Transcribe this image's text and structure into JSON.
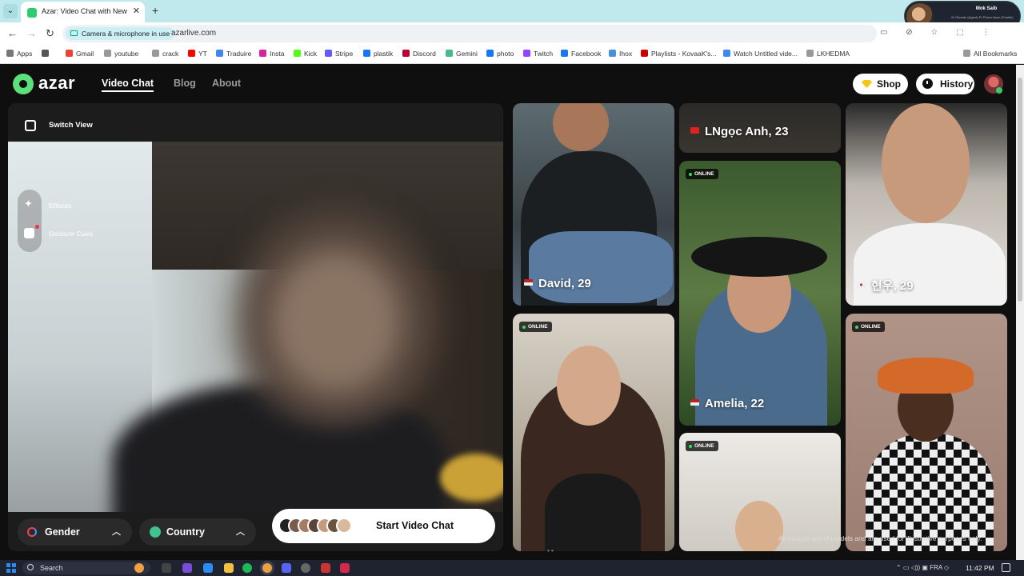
{
  "browser": {
    "tab_title": "Azar: Video Chat with New",
    "address_chip": "Camera & microphone in use",
    "url": "azarlive.com",
    "profile_name": "Mok Saib",
    "profile_sub": "El Ghoster (Agent) Pr Ploiva Issuz (Charlie)",
    "bookmarks": [
      "Apps",
      "Gmail",
      "youtube",
      "crack",
      "YT",
      "Traduire",
      "Insta",
      "Kick",
      "Stripe",
      "plastik",
      "Discord",
      "Gemini",
      "photo",
      "Twitch",
      "Facebook",
      "Ihox",
      "Playlists - KovaaK's...",
      "Watch Untitled vide...",
      "LKHEDMA"
    ],
    "all_bookmarks": "All Bookmarks"
  },
  "site": {
    "logo": "azar",
    "nav": {
      "video_chat": "Video Chat",
      "blog": "Blog",
      "about": "About"
    },
    "shop": "Shop",
    "history": "History"
  },
  "panel": {
    "switch_view": "Switch View",
    "effects": "Effects",
    "gesture": "Gesture Cues",
    "gender": "Gender",
    "country": "Country",
    "start": "Start Video Chat"
  },
  "cards": {
    "david": {
      "name": "David, 29"
    },
    "lngoc": {
      "name": "LNgọc Anh, 23"
    },
    "hyunwoo": {
      "name": "현우, 29"
    },
    "amelia": {
      "name": "Amelia, 22"
    },
    "online": "ONLINE"
  },
  "disclaimer": "All images are of models and are used for illustrative purposes only.",
  "taskbar": {
    "search": "Search",
    "lang": "FRA",
    "time": "11:42 PM"
  },
  "colors": {
    "brand": "#5ce07a",
    "online_dot": "#33dd66"
  }
}
